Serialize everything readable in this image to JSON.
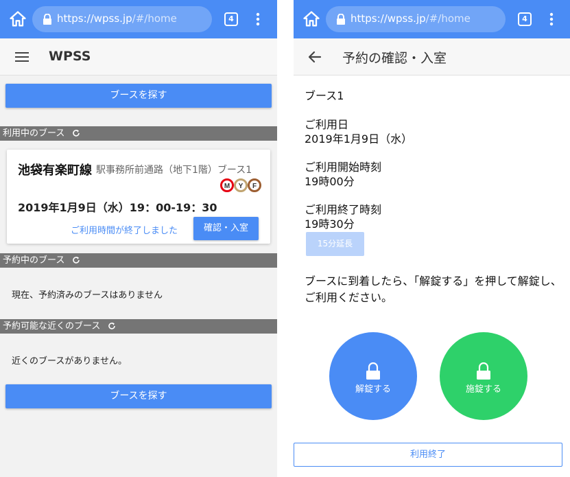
{
  "left": {
    "browser": {
      "url_host": "https://wpss.jp",
      "url_path": "/#/home",
      "tab_count": "4"
    },
    "app_title": "WPSS",
    "find_booth_top_label": "ブースを探す",
    "sections": {
      "in_use": "利用中のブース",
      "reserved": "予約中のブース",
      "nearby": "予約可能な近くのブース"
    },
    "booking": {
      "line_name": "池袋有楽町線",
      "location": "駅事務所前通路（地下1階）ブース1",
      "line_badges": [
        "M",
        "Y",
        "F"
      ],
      "datetime": "2019年1月9日（水）19：00-19：30",
      "ended_text": "ご利用時間が終了しました",
      "confirm_label": "確認・入室"
    },
    "reserved_empty": "現在、予約済みのブースはありません",
    "nearby_empty": "近くのブースがありません。",
    "find_booth_bottom_label": "ブースを探す",
    "colors": {
      "primary": "#4a8cf5",
      "section_bar": "#757575"
    }
  },
  "right": {
    "browser": {
      "url_host": "https://wpss.jp",
      "url_path": "/#/home",
      "tab_count": "4"
    },
    "title": "予約の確認・入室",
    "booth_name": "ブース1",
    "date_label": "ご利用日",
    "date_value": "2019年1月9日（水）",
    "start_label": "ご利用開始時刻",
    "start_value": "19時00分",
    "end_label": "ご利用終了時刻",
    "end_value": "19時30分",
    "extend_label": "15分延長",
    "instruction": "ブースに到着したら、「解錠する」を押して解錠し、ご利用ください。",
    "unlock_label": "解錠する",
    "lock_label": "施錠する",
    "finish_label": "利用終了",
    "colors": {
      "unlock": "#4a8cf5",
      "lock": "#2ed16a",
      "extend_disabled": "#bad3fb"
    }
  }
}
